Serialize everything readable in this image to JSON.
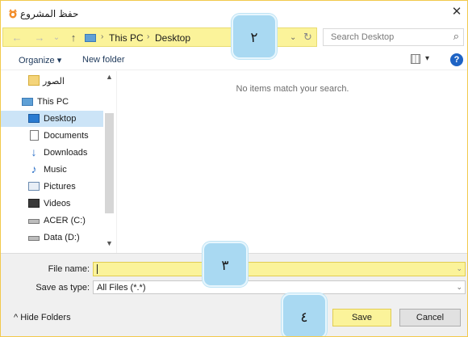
{
  "window": {
    "title": "حفظ المشروع",
    "close_glyph": "✕"
  },
  "address": {
    "back_glyph": "←",
    "forward_glyph": "→",
    "recent_glyph": "⌄",
    "up_glyph": "↑",
    "crumbs": [
      "This PC",
      "Desktop"
    ],
    "crumb_separator": "›",
    "dropdown_glyph": "⌄",
    "refresh_glyph": "↻"
  },
  "search": {
    "placeholder": "Search Desktop",
    "icon_glyph": "⌕"
  },
  "toolbar": {
    "organize_label": "Organize ▾",
    "new_folder_label": "New folder",
    "view_arrow": "▾",
    "help_glyph": "?"
  },
  "nav": {
    "items": [
      {
        "label": "الصور",
        "icon": "folder-icon"
      },
      {
        "label": "This PC",
        "icon": "computer-icon"
      },
      {
        "label": "Desktop",
        "icon": "desktop-icon",
        "selected": true
      },
      {
        "label": "Documents",
        "icon": "documents-icon"
      },
      {
        "label": "Downloads",
        "icon": "downloads-icon"
      },
      {
        "label": "Music",
        "icon": "music-icon"
      },
      {
        "label": "Pictures",
        "icon": "pictures-icon"
      },
      {
        "label": "Videos",
        "icon": "videos-icon"
      },
      {
        "label": "ACER (C:)",
        "icon": "drive-icon"
      },
      {
        "label": "Data (D:)",
        "icon": "drive-icon"
      }
    ],
    "scroll_up": "▲",
    "scroll_down": "▼"
  },
  "content": {
    "empty_message": "No items match your search."
  },
  "form": {
    "file_name_label": "File name:",
    "file_name_value": "",
    "save_as_type_label": "Save as type:",
    "save_as_type_value": "All Files (*.*)",
    "dropdown_glyph": "⌄"
  },
  "footer": {
    "hide_folders_label": "^  Hide Folders",
    "save_label": "Save",
    "cancel_label": "Cancel"
  },
  "callouts": [
    "٢",
    "٣",
    "٤"
  ],
  "colors": {
    "highlight": "#fbf39a",
    "callout": "#a9d9f2",
    "selection": "#cce4f7",
    "accent_blue": "#1e63c4"
  }
}
